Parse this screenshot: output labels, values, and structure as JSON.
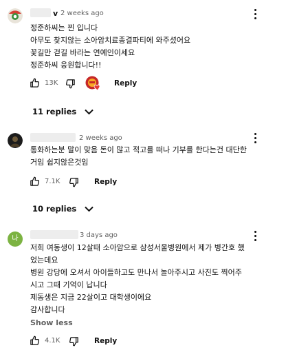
{
  "comments": [
    {
      "name_tail": "v",
      "time": "2 weeks ago",
      "lines": [
        "정준하씨는 찐 입니다",
        "아무도 찾지않는 소아암치료종결파티에 와주셨어요",
        "꽃길만 걷길 바라는 연예인이세요",
        "정준하씨 응원합니다!!"
      ],
      "likes": "13K",
      "reply_label": "Reply",
      "replies_label": "11 replies"
    },
    {
      "time": "2 weeks ago",
      "lines": [
        "통화하는분 말이 맞음 돈이 많고 적고를 떠나 기부를 한다는건 대단한",
        "거임 쉽지않은것임"
      ],
      "likes": "7.1K",
      "reply_label": "Reply",
      "replies_label": "10 replies"
    },
    {
      "avatar_letter": "나",
      "time": "3 days ago",
      "lines": [
        "저희 여동생이 12살때 소아암으로 삼성서울병원에서 제가 병간호 했",
        "었는데요",
        "병원 강당에 오셔서 아이들하고도 만나서 놀아주시고 사진도 찍어주",
        "시고 그때 기억이 납니다",
        "제동생은 지금 22살이고 대학생이에요",
        "감사합니다"
      ],
      "show_less": "Show less",
      "likes": "4.1K",
      "reply_label": "Reply"
    }
  ],
  "colors": {
    "secondary_text": "#606060",
    "avatar3_bg": "#7cb342",
    "heart_red": "#e53935"
  }
}
